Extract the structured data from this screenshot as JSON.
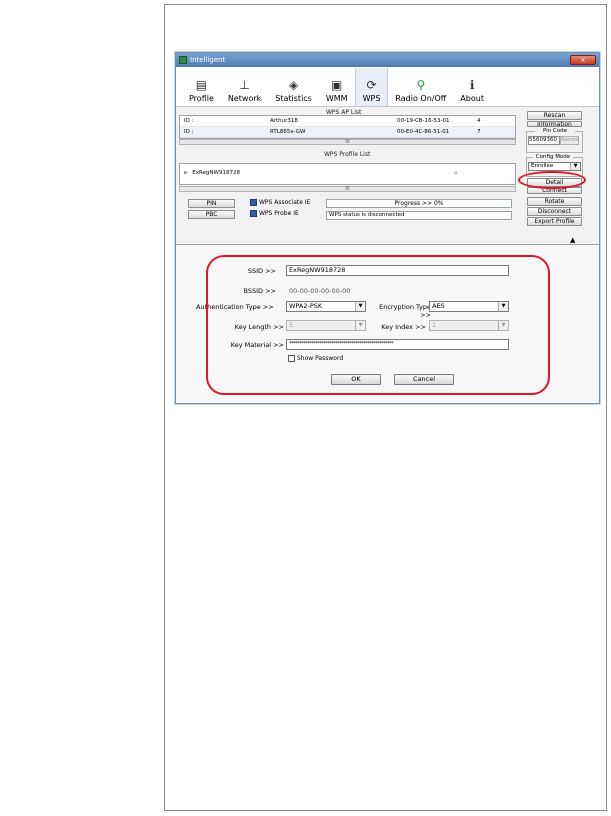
{
  "window": {
    "title": "Intelligent",
    "close_label": "x"
  },
  "toolbar": [
    {
      "label": "Profile",
      "icon": "profile-icon",
      "glyph": "▤"
    },
    {
      "label": "Network",
      "icon": "network-icon",
      "glyph": "⊥"
    },
    {
      "label": "Statistics",
      "icon": "statistics-icon",
      "glyph": "◈"
    },
    {
      "label": "WMM",
      "icon": "wmm-icon",
      "glyph": "▣"
    },
    {
      "label": "WPS",
      "icon": "wps-icon",
      "glyph": "⟳"
    },
    {
      "label": "Radio On/Off",
      "icon": "radio-icon",
      "glyph": "⚲"
    },
    {
      "label": "About",
      "icon": "about-icon",
      "glyph": "ℹ"
    }
  ],
  "wps_ap_list": {
    "title": "WPS AP List",
    "rows": [
      {
        "id": "ID :",
        "ssid": "Arthur318",
        "bssid": "00-19-CB-16-53-01",
        "ch": "4"
      },
      {
        "id": "ID :",
        "ssid": "RTL865x-GW",
        "bssid": "00-E0-4C-86-51-01",
        "ch": "7"
      }
    ],
    "scroll_mark": "III"
  },
  "wps_profile_list": {
    "title": "WPS Profile List",
    "rows": [
      {
        "name": "ExRegNW918728"
      }
    ],
    "scroll_mark": "III"
  },
  "right_panel": {
    "rescan": "Rescan",
    "information": "Information",
    "pin_code_title": "Pin Code",
    "pin_code_value": "55609360",
    "renew": "Renew",
    "config_mode_title": "Config Mode",
    "config_mode_value": "Enrollee",
    "detail": "Detail",
    "connect": "Connect",
    "rotate": "Rotate",
    "disconnect": "Disconnect",
    "export_profile": "Export Profile"
  },
  "wps_actions": {
    "pin": "PIN",
    "pbc": "PBC",
    "associate_ie": "WPS Associate IE",
    "probe_ie": "WPS Probe IE",
    "progress": "Progress >> 0%",
    "status": "WPS status is disconnected"
  },
  "detail_form": {
    "ssid_label": "SSID >>",
    "ssid_value": "ExRegNW918728",
    "bssid_label": "BSSID >>",
    "bssid_value": "00-00-00-00-00-00",
    "auth_label": "Authentication Type >>",
    "auth_value": "WPA2-PSK",
    "enc_label": "Encryption Type >>",
    "enc_value": "AES",
    "keylen_label": "Key Length >>",
    "keylen_value": "5",
    "keyindex_label": "Key Index >>",
    "keyindex_value": "1",
    "keymat_label": "Key Material >>",
    "keymat_value": "****************************************************",
    "show_password": "Show Password",
    "ok": "OK",
    "cancel": "Cancel"
  }
}
